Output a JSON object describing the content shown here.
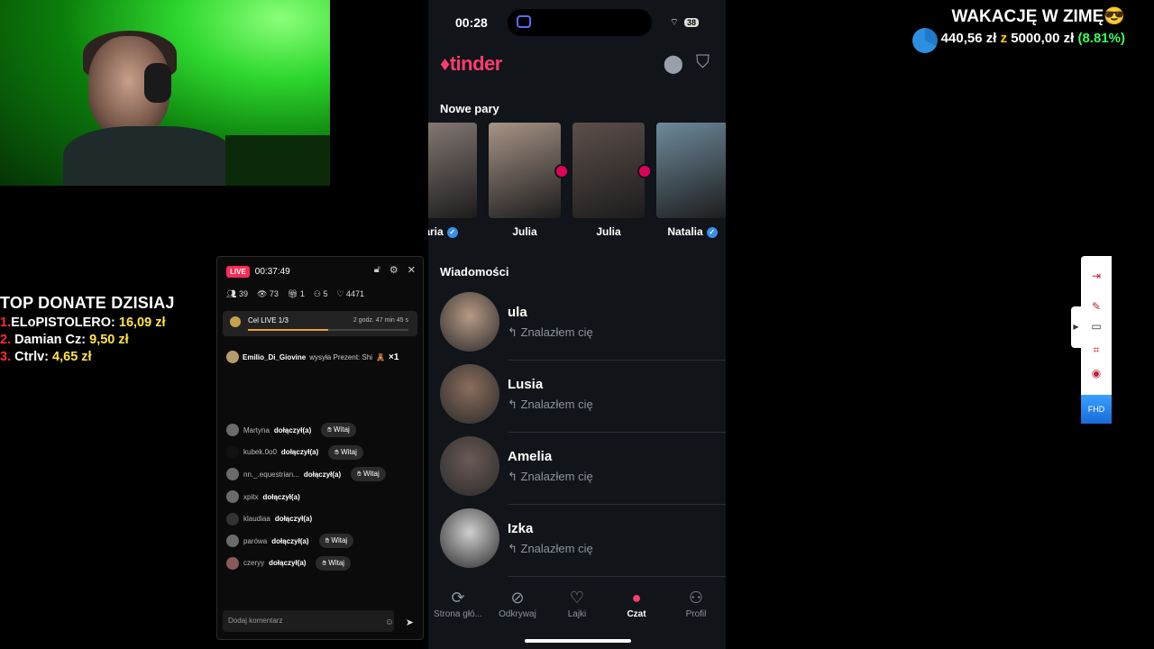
{
  "donate": {
    "title": "TOP DONATE DZISIAJ",
    "entries": [
      {
        "rank": "1.",
        "name": "ELoPISTOLERO:",
        "amount": "16,09 zł"
      },
      {
        "rank": "2.",
        "name": "Damian Cz:",
        "amount": "9,50 zł"
      },
      {
        "rank": "3.",
        "name": "Ctrlv:",
        "amount": "4,65 zł"
      }
    ]
  },
  "goal": {
    "title": "WAKACJĘ W ZIMĘ",
    "emoji": "😎",
    "current": "440,56 zł",
    "separator": "z",
    "target": "5000,00 zł",
    "percent": "(8.81%)",
    "fraction": 0.0881
  },
  "live": {
    "badge": "LIVE",
    "timer": "00:37:49",
    "stats": [
      "39",
      "73",
      "1",
      "5",
      "4471"
    ],
    "goal_label": "Cel LIVE 1/3",
    "goal_time": "2 godz. 47 min 45 s",
    "goal_fraction": 0.5,
    "gift": {
      "user": "Emilio_Di_Giovine",
      "text": "wysyła Prezent: Shi",
      "count": "×1"
    },
    "chat": [
      {
        "user": "Martyna",
        "action": "dołączył(a)",
        "button": "Witaj"
      },
      {
        "user": "kubek.0o0",
        "action": "dołączył(a)",
        "button": "Witaj"
      },
      {
        "user": "nn._.equestrian...",
        "action": "dołączył(a)",
        "button": "Witaj"
      },
      {
        "user": "xpitx",
        "action": "dołączył(a)",
        "button": ""
      },
      {
        "user": "klaudiaa",
        "action": "dołączył(a)",
        "button": ""
      },
      {
        "user": "parówa",
        "action": "dołączył(a)",
        "button": "Witaj"
      },
      {
        "user": "czeryy",
        "action": "dołączył(a)",
        "button": "Witaj"
      }
    ],
    "comment_placeholder": "Dodaj komentarz"
  },
  "phone": {
    "time": "00:28",
    "battery": "38",
    "logo": "tinder",
    "new_matches_title": "Nowe pary",
    "matches": [
      {
        "name": "aria",
        "verified": true,
        "color": "#8a7e78"
      },
      {
        "name": "Julia",
        "verified": false,
        "color": "#a79486"
      },
      {
        "name": "Julia",
        "verified": false,
        "color": "#5c4f4a"
      },
      {
        "name": "Natalia",
        "verified": true,
        "color": "#6e8a9c"
      }
    ],
    "messages_title": "Wiadomości",
    "messages": [
      {
        "name": "ula",
        "preview": "Znalazłem cię",
        "color": "#b89a86"
      },
      {
        "name": "Lusia",
        "preview": "Znalazłem cię",
        "color": "#8a6d5c"
      },
      {
        "name": "Amelia",
        "preview": "Znalazłem cię",
        "color": "#6a5a55"
      },
      {
        "name": "Izka",
        "preview": "Znalazłem cię",
        "color": "#cfcfcf"
      }
    ],
    "nav": [
      {
        "label": "Strona głó...",
        "icon": "⟳"
      },
      {
        "label": "Odkrywaj",
        "icon": "⊘"
      },
      {
        "label": "Lajki",
        "icon": "♡"
      },
      {
        "label": "Czat",
        "icon": "●"
      },
      {
        "label": "Profil",
        "icon": "⚇"
      }
    ]
  },
  "toolbar": {
    "fhd": "FHD"
  }
}
